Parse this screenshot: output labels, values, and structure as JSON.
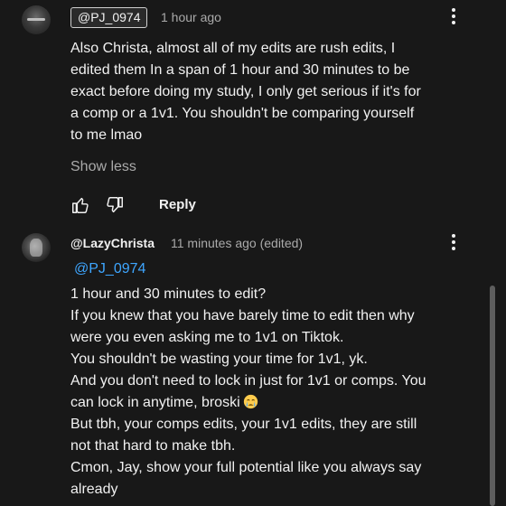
{
  "comment1": {
    "handle": "@PJ_0974",
    "time": "1 hour ago",
    "lines": [
      "Also Christa, almost all of my edits are rush edits, I",
      "edited them In a span of 1 hour and 30 minutes to be",
      "exact before doing my study, I only get serious if it's for",
      "a comp or a 1v1. You shouldn't be comparing yourself",
      "to me lmao"
    ],
    "show_less": "Show less",
    "reply": "Reply"
  },
  "comment2": {
    "author": "@LazyChrista",
    "time": "11 minutes ago (edited)",
    "mention": "@PJ_0974",
    "lines": [
      "1 hour and 30 minutes to edit?",
      "If you knew that you have barely time to edit then why",
      "were you even asking me to 1v1 on Tiktok.",
      "You shouldn't be wasting your time for 1v1, yk.",
      "And you don't need to lock in just for 1v1 or comps. You",
      "can lock in anytime, broski",
      "But tbh, your comps edits, your 1v1 edits, they are still",
      "not that hard to make tbh.",
      "Cmon, Jay, show your full potential like you always say",
      "already"
    ],
    "emoji": "crying-face-emoji"
  },
  "colors": {
    "background": "#181818",
    "text": "#f1f1f1",
    "secondary": "#aaaaaa",
    "link": "#3ea6ff"
  }
}
